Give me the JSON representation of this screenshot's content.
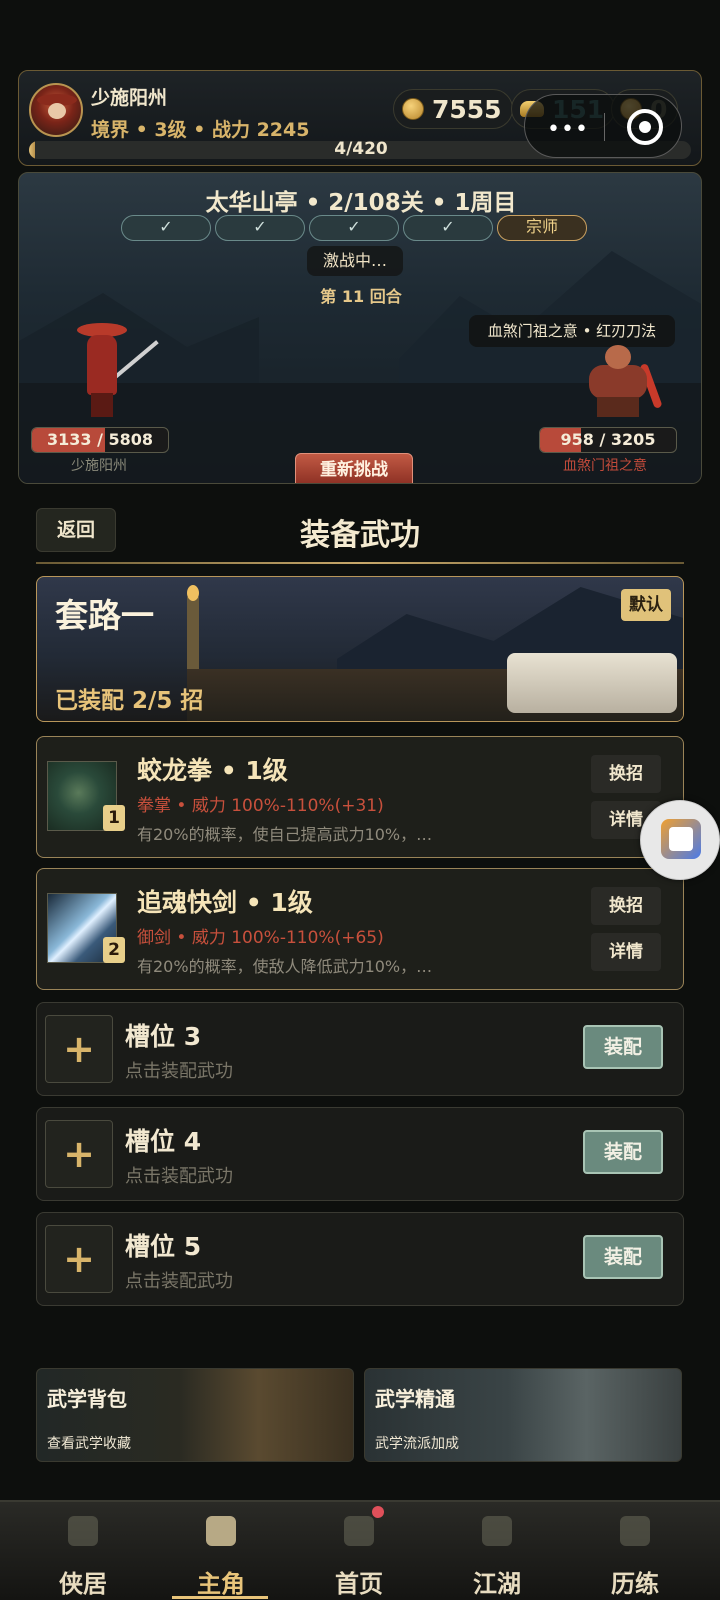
{
  "player": {
    "name": "少施阳州",
    "level_line": "境界 • 3级 • 战力 2245",
    "xp_text": "4/420",
    "xp_progress": 0.0095,
    "gold": "7555",
    "ingot": "151",
    "ticket": "0"
  },
  "battle": {
    "stage_title": "太华山亭 • 2/108关 • 1周目",
    "tiers": [
      "✓",
      "✓",
      "✓",
      "✓",
      "宗师"
    ],
    "status": "激战中…",
    "round": "第 11 回合",
    "boss_tag": "血煞门祖之意 • 红刃刀法",
    "hero_hp": "3133 / 5808",
    "hero_hp_ratio": 0.54,
    "hero_name": "少施阳州",
    "boss_hp": "958 / 3205",
    "boss_hp_ratio": 0.3,
    "boss_name": "血煞门祖之意",
    "retry_label": "重新挑战"
  },
  "header": {
    "back_label": "返回",
    "title": "装备武功"
  },
  "set": {
    "name": "套路一",
    "default_badge": "默认",
    "equipped_text": "已装配 2/5 招"
  },
  "skills": [
    {
      "slot": "1",
      "title": "蛟龙拳 • 1级",
      "type_line": "拳掌 • 威力 100%-110%(+31)",
      "desc": "有20%的概率，使自己提高武力10%，…",
      "swap_label": "换招",
      "detail_label": "详情"
    },
    {
      "slot": "2",
      "title": "追魂快剑 • 1级",
      "type_line": "御剑 • 威力 100%-110%(+65)",
      "desc": "有20%的概率，使敌人降低武力10%，…",
      "swap_label": "换招",
      "detail_label": "详情"
    }
  ],
  "empty_slots": [
    {
      "title": "槽位 3",
      "sub": "点击装配武功",
      "button": "装配"
    },
    {
      "title": "槽位 4",
      "sub": "点击装配武功",
      "button": "装配"
    },
    {
      "title": "槽位 5",
      "sub": "点击装配武功",
      "button": "装配"
    }
  ],
  "cards": [
    {
      "title": "武学背包",
      "sub": "查看武学收藏"
    },
    {
      "title": "武学精通",
      "sub": "武学流派加成"
    }
  ],
  "tabs": [
    {
      "label": "侠居",
      "icon": "house-icon"
    },
    {
      "label": "主角",
      "icon": "hero-icon"
    },
    {
      "label": "首页",
      "icon": "home-icon"
    },
    {
      "label": "江湖",
      "icon": "mountain-icon"
    },
    {
      "label": "历练",
      "icon": "crossed-swords-icon"
    }
  ],
  "active_tab": 1,
  "plus_symbol": "+",
  "capsule": {
    "more": "•••"
  }
}
